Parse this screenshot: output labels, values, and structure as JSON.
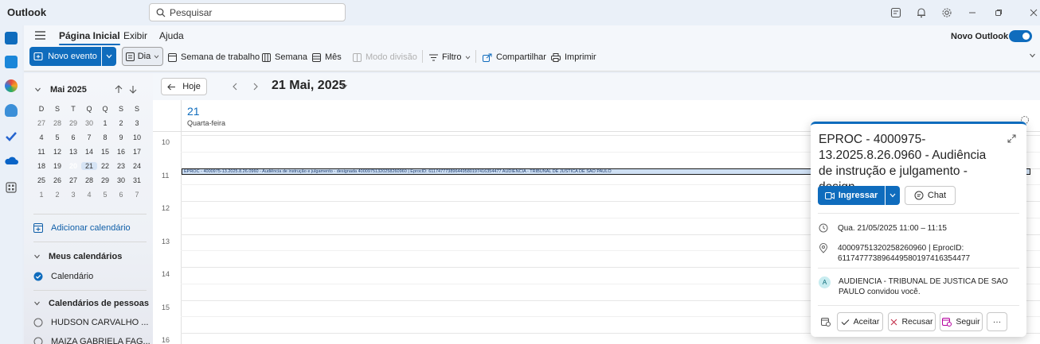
{
  "app": {
    "title": "Outlook"
  },
  "search": {
    "placeholder": "Pesquisar"
  },
  "ribbon": {
    "tabs": [
      "Página Inicial",
      "Exibir",
      "Ajuda"
    ],
    "new_outlook_label": "Novo Outlook",
    "new_event_label": "Novo evento",
    "view_day": "Dia",
    "view_work_week": "Semana de trabalho",
    "view_week": "Semana",
    "view_month": "Mês",
    "view_split": "Modo divisão",
    "filter": "Filtro",
    "share": "Compartilhar",
    "print": "Imprimir"
  },
  "mini_calendar": {
    "title": "Mai 2025",
    "weekdays": [
      "D",
      "S",
      "T",
      "Q",
      "Q",
      "S",
      "S"
    ],
    "weeks": [
      [
        "27",
        "28",
        "29",
        "30",
        "1",
        "2",
        "3"
      ],
      [
        "4",
        "5",
        "6",
        "7",
        "8",
        "9",
        "10"
      ],
      [
        "11",
        "12",
        "13",
        "14",
        "15",
        "16",
        "17"
      ],
      [
        "18",
        "19",
        "20",
        "21",
        "22",
        "23",
        "24"
      ],
      [
        "25",
        "26",
        "27",
        "28",
        "29",
        "30",
        "31"
      ],
      [
        "1",
        "2",
        "3",
        "4",
        "5",
        "6",
        "7"
      ]
    ],
    "today": "20",
    "selected": "21"
  },
  "left_panel": {
    "add_calendar": "Adicionar calendário",
    "my_calendars": "Meus calendários",
    "calendar_item": "Calendário",
    "people_calendars": "Calendários de pessoas",
    "people": [
      "HUDSON CARVALHO ...",
      "MAIZA GABRIELA FAG..."
    ]
  },
  "calendar": {
    "today_label": "Hoje",
    "date_title": "21 Mai, 2025",
    "day_number": "21",
    "day_name": "Quarta-feira",
    "hours": [
      "10",
      "11",
      "12",
      "13",
      "14",
      "15",
      "16"
    ],
    "event_text": "EPROC - 4000975-13.2025.8.26.0960 - Audiência de instrução e julgamento - designada 40009751320258260960 | EprocID: 6117477738964495801974163544​77 AUDIENCIA - TRIBUNAL DE JUSTICA DE SAO PAULO"
  },
  "popup": {
    "title": "EPROC - 4000975-13.2025.8.26.0960 - Audiência de instrução e julgamento - design...",
    "join_label": "Ingressar",
    "chat_label": "Chat",
    "datetime": "Qua. 21/05/2025 11:00 – 11:15",
    "location": "40009751320258260960 | EprocID: 611747773896449580197416354477",
    "organizer_initial": "A",
    "organizer": "AUDIENCIA - TRIBUNAL DE JUSTICA DE SAO PAULO convidou você.",
    "accept": "Aceitar",
    "decline": "Recusar",
    "follow": "Seguir",
    "more": "···"
  },
  "colors": {
    "accent": "#0f6cbd"
  }
}
